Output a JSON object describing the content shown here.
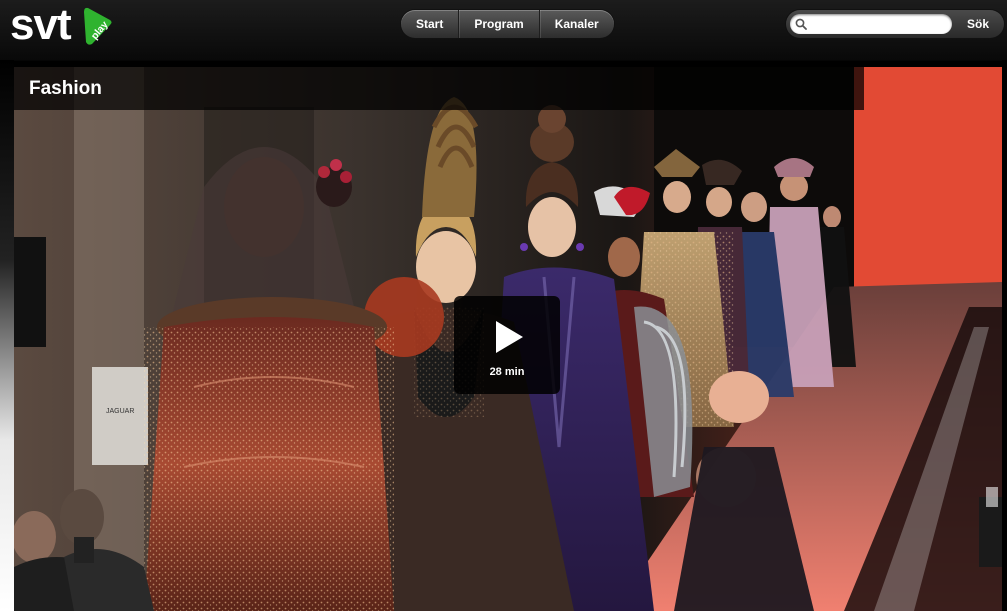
{
  "logo": {
    "brand": "svt",
    "badge": "play",
    "brand_color": "#ffffff",
    "badge_color": "#2fb32f"
  },
  "nav": {
    "items": [
      {
        "label": "Start"
      },
      {
        "label": "Program"
      },
      {
        "label": "Kanaler"
      }
    ]
  },
  "search": {
    "icon": "search-icon",
    "value": "",
    "placeholder": "",
    "button_label": "Sök"
  },
  "hero": {
    "title": "Fashion",
    "duration": "28 min",
    "play_icon": "play-icon",
    "accent_color": "#e8523a"
  }
}
